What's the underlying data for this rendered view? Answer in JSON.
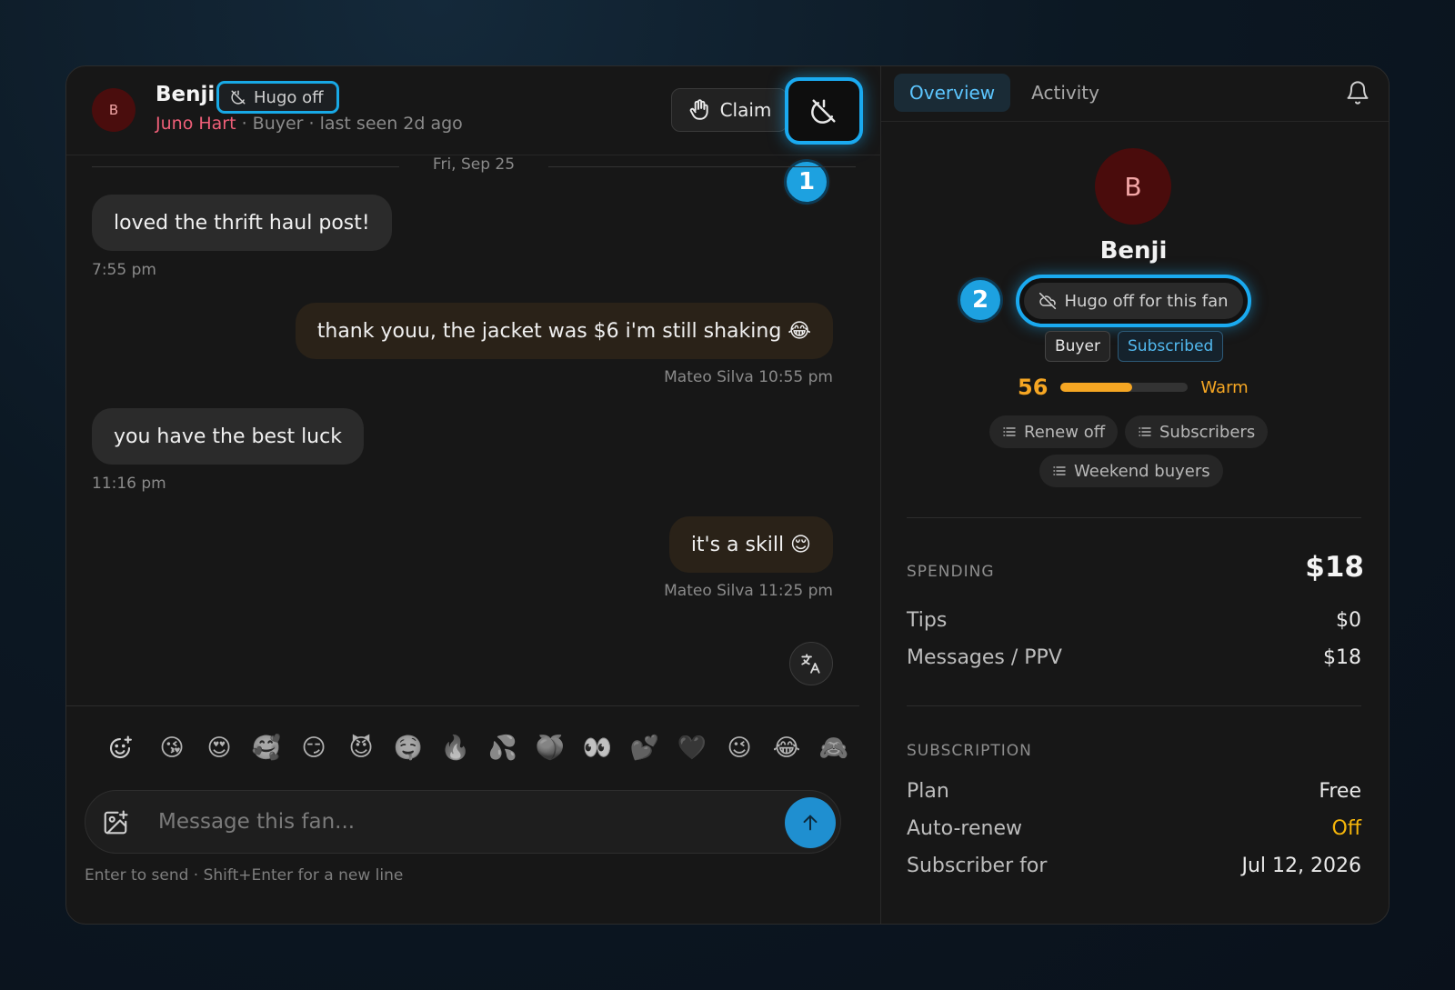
{
  "header": {
    "avatar_initial": "B",
    "fan_name": "Benji",
    "hugo_status": "Hugo off",
    "creator": "Juno Hart",
    "subline": " · Buyer · last seen 2d ago",
    "claim_label": "Claim",
    "badge_1": "1"
  },
  "messages": {
    "date": "Fri, Sep 25",
    "items": [
      {
        "text": "loved the thrift haul post!",
        "meta": "7:55 pm",
        "dir": "in"
      },
      {
        "text": "thank youu, the jacket was $6 i'm still shaking 😂",
        "meta": "Mateo Silva  10:55 pm",
        "dir": "out"
      },
      {
        "text": "you have the best luck",
        "meta": "11:16 pm",
        "dir": "in"
      },
      {
        "text": "it's a skill 😌",
        "meta": "Mateo Silva  11:25 pm",
        "dir": "out"
      }
    ]
  },
  "composer": {
    "emojis": [
      "😘",
      "😍",
      "🥰",
      "😏",
      "😈",
      "🤤",
      "🔥",
      "💦",
      "🍑",
      "👀",
      "💕",
      "🖤",
      "😉",
      "😂",
      "🙈"
    ],
    "placeholder": "Message this fan...",
    "value": "",
    "hint": "Enter to send · Shift+Enter for a new line"
  },
  "side": {
    "tabs": [
      "Overview",
      "Activity"
    ],
    "active_tab": "Overview",
    "avatar_initial": "B",
    "name": "Benji",
    "hugo_fan": "Hugo off for this fan",
    "badge_2": "2",
    "tags": [
      "Buyer",
      "Subscribed"
    ],
    "score": 56,
    "score_fraction": 0.56,
    "score_label": "Warm",
    "lists": [
      "Renew off",
      "Subscribers",
      "Weekend buyers"
    ],
    "spending": {
      "label": "SPENDING",
      "total": "$18",
      "rows": [
        {
          "k": "Tips",
          "v": "$0"
        },
        {
          "k": "Messages / PPV",
          "v": "$18"
        }
      ]
    },
    "subscription": {
      "label": "SUBSCRIPTION",
      "rows": [
        {
          "k": "Plan",
          "v": "Free"
        },
        {
          "k": "Auto-renew",
          "v": "Off"
        },
        {
          "k": "Subscriber for",
          "v": "Jul 12, 2026"
        }
      ]
    }
  },
  "colors": {
    "accent": "#1aaaf0",
    "creator": "#ef5f78",
    "warm": "#f5a623",
    "warn": "#f5b50a"
  }
}
